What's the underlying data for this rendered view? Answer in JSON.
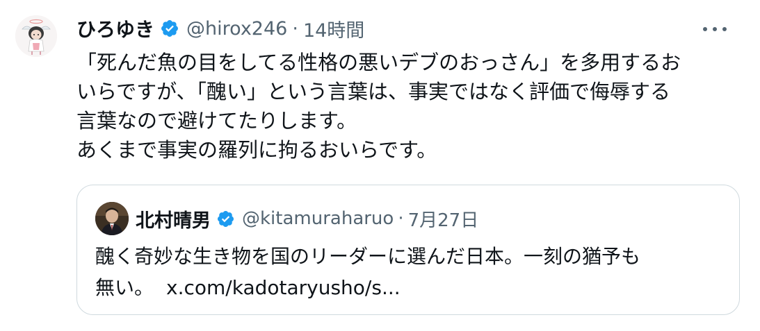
{
  "tweet": {
    "author_name": "ひろゆき",
    "handle": "@hirox246",
    "separator": "·",
    "time": "14時間",
    "verified_icon": "verified-badge-icon",
    "more_icon": "more-icon",
    "body_lines": [
      "「死んだ魚の目をしてる性格の悪いデブのおっさん」を多用するお",
      "いらですが、「醜い」という言葉は、事実ではなく評価で侮辱する",
      "言葉なので避けてたりします。",
      "あくまで事実の羅列に拘るおいらです。"
    ]
  },
  "quote": {
    "author_name": "北村晴男",
    "handle": "@kitamuraharuo",
    "separator": "·",
    "time": "7月27日",
    "verified_icon": "verified-badge-icon",
    "body_lines": [
      "醜く奇妙な生き物を国のリーダーに選んだ日本。一刻の猶予も",
      "無い。"
    ],
    "link": "x.com/kadotaryusho/s..."
  },
  "colors": {
    "text": "#0f1419",
    "secondary": "#536471",
    "verified": "#1d9bf0",
    "border": "#cfd9de"
  }
}
